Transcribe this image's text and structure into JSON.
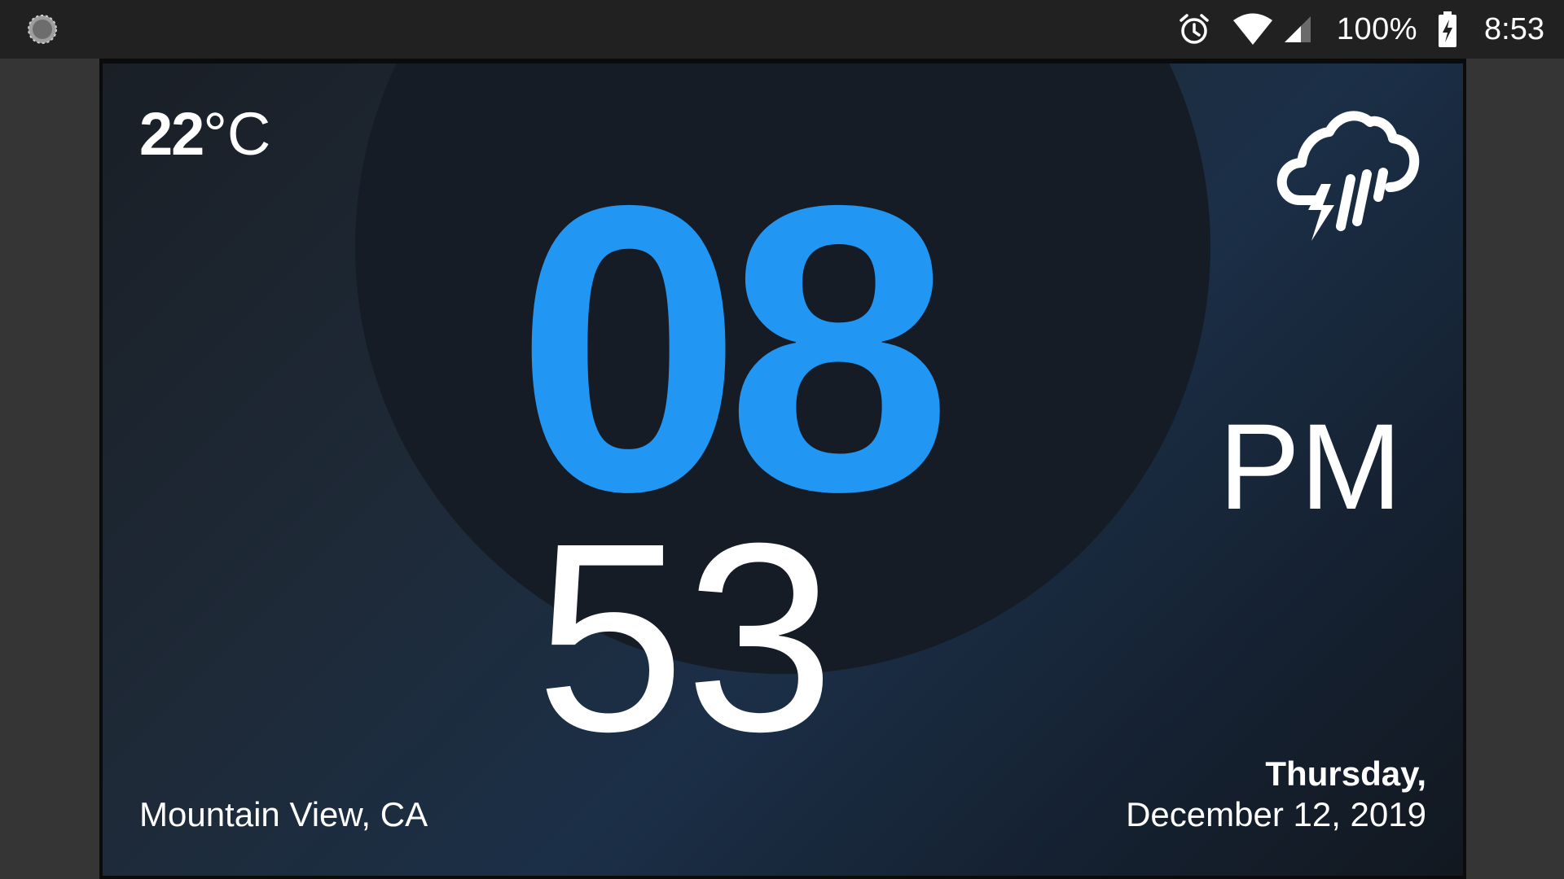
{
  "status_bar": {
    "left_icon": "app-loading-icon",
    "icons": [
      "alarm-icon",
      "wifi-icon",
      "cell-signal-icon",
      "battery-charging-icon"
    ],
    "battery": "100%",
    "time": "8:53"
  },
  "clock": {
    "temperature_value": "22",
    "temperature_unit": "°C",
    "weather_icon": "thunderstorm-rain-icon",
    "hour": "08",
    "minute": "53",
    "ampm": "PM",
    "location": "Mountain View, CA",
    "day": "Thursday,",
    "date": "December 12, 2019"
  },
  "colors": {
    "hour": "#2196f3",
    "text": "#ffffff",
    "status_bar_bg": "#212121"
  }
}
